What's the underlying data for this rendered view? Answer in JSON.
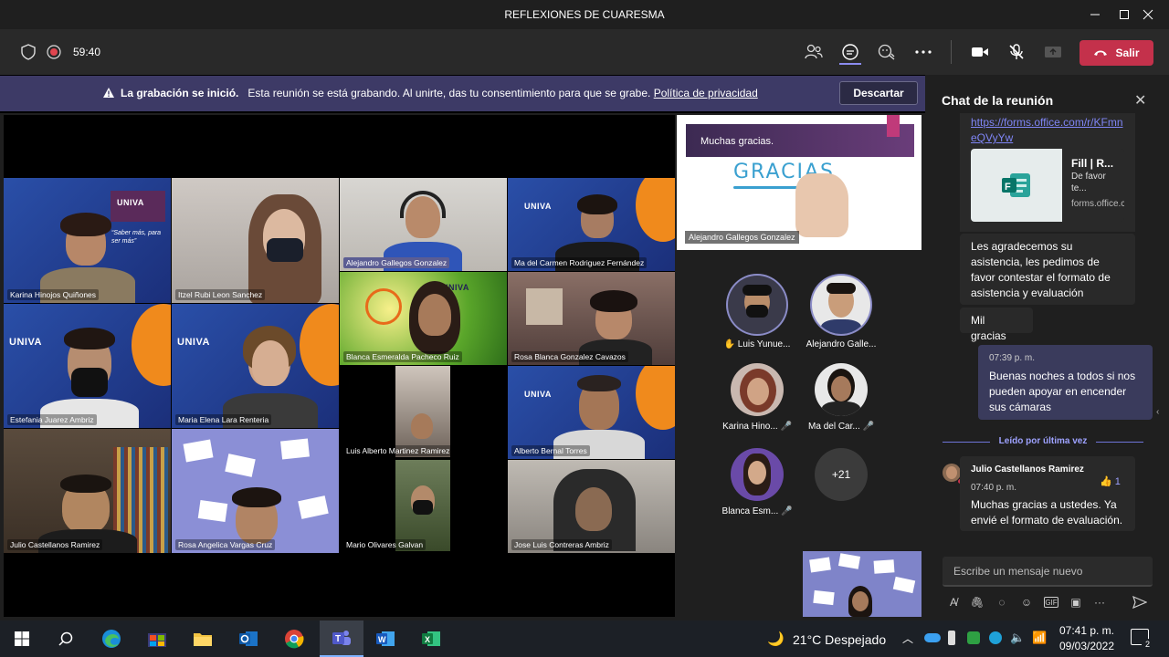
{
  "window": {
    "title": "REFLEXIONES DE CUARESMA"
  },
  "toolbar": {
    "timer": "59:40",
    "leave_label": "Salir"
  },
  "banner": {
    "bold": "La grabación se inició.",
    "text": "Esta reunión se está grabando. Al unirte, das tu consentimiento para que se grabe.",
    "link": "Política de privacidad",
    "dismiss_label": "Descartar"
  },
  "gallery": {
    "tiles": [
      "Karina Hinojos Quiñones",
      "Itzel Rubi Leon Sanchez",
      "Alejandro Gallegos Gonzalez",
      "Ma del Carmen Rodriguez Fernández",
      "Estefania Juarez Ambriz",
      "Maria Elena Lara Renteria",
      "Blanca Esmeralda Pacheco Ruiz",
      "Rosa Blanca Gonzalez Cavazos",
      "Luis Alberto Martinez Ramirez",
      "Alberto Bernal Torres",
      "Julio Castellanos Ramirez",
      "Rosa Angelica Vargas Cruz",
      "Mario Olivares Galvan",
      "Jose Luis Contreras Ambriz"
    ],
    "univa_label": "UNIVA",
    "univa_tagline": "“Saber más, para ser más”"
  },
  "shared": {
    "caption": "Muchas gracias.",
    "word": "GRACIAS",
    "presenter": "Alejandro Gallegos Gonzalez"
  },
  "roster": [
    {
      "name": "Luis Yunue...",
      "hand": "✋"
    },
    {
      "name": "Alejandro Galle..."
    },
    {
      "name": "Karina Hino..."
    },
    {
      "name": "Ma del Car..."
    },
    {
      "name": "Blanca Esm..."
    }
  ],
  "roster_overflow": "+21",
  "chat": {
    "title": "Chat de la reunión",
    "link_lines": [
      "https://forms.office.com/r/KFmn",
      "eQVyYw"
    ],
    "card": {
      "title": "Fill | R...",
      "desc": "De favor te...",
      "url": "forms.office.com"
    },
    "msg1": "Les agradecemos su asistencia, les pedimos de favor contestar el formato de asistencia y evaluación",
    "msg2": "Mil gracias",
    "mine_time": "07:39 p. m.",
    "mine_text": "Buenas noches a todos si nos pueden apoyar en encender sus cámaras",
    "read_marker": "Leído por última vez",
    "reply_author": "Julio Castellanos Ramirez",
    "reply_time": "07:40 p. m.",
    "reply_text": "Muchas gracias a ustedes. Ya envié el formato de evaluación.",
    "reaction_count": "1",
    "compose_placeholder": "Escribe un mensaje nuevo"
  },
  "taskbar": {
    "weather": "21°C  Despejado",
    "time": "07:41 p. m.",
    "date": "09/03/2022",
    "notifications": "2"
  }
}
